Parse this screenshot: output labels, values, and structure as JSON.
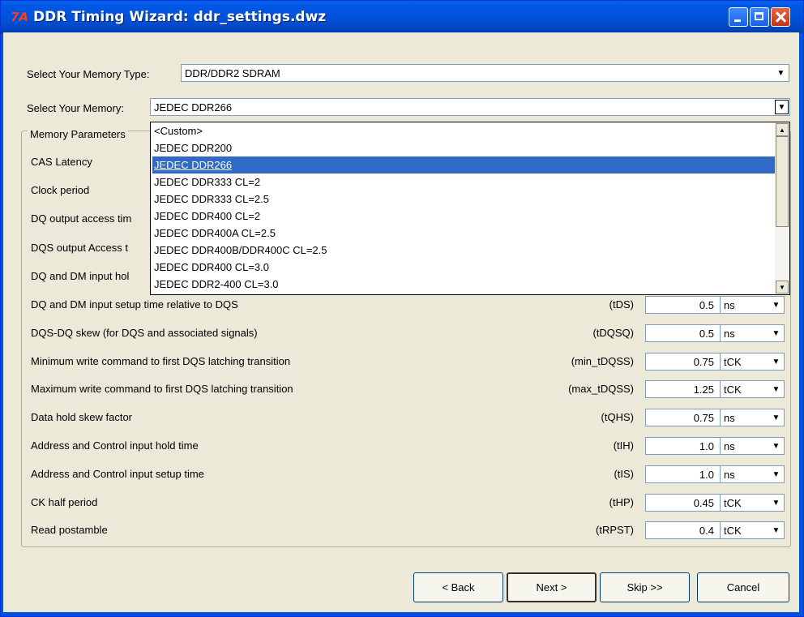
{
  "window": {
    "icon_text": "7A",
    "title": "DDR Timing Wizard: ddr_settings.dwz"
  },
  "memory_type": {
    "label": "Select Your Memory Type:",
    "value": "DDR/DDR2 SDRAM"
  },
  "memory": {
    "label": "Select Your Memory:",
    "value": "JEDEC DDR266",
    "options": [
      "<Custom>",
      "JEDEC DDR200",
      "JEDEC DDR266",
      "JEDEC DDR333 CL=2",
      "JEDEC DDR333 CL=2.5",
      "JEDEC DDR400 CL=2",
      "JEDEC DDR400A CL=2.5",
      "JEDEC DDR400B/DDR400C CL=2.5",
      "JEDEC DDR400 CL=3.0",
      "JEDEC DDR2-400 CL=3.0"
    ],
    "selected_index": 2
  },
  "parameters": {
    "group_title": "Memory Parameters",
    "hidden_labels": [
      "CAS Latency",
      "Clock period",
      "DQ output access tim",
      "DQS output Access t",
      "DQ and DM input hol"
    ],
    "rows": [
      {
        "label": "DQ and DM input setup time relative to DQS",
        "symbol": "(tDS)",
        "value": "0.5",
        "unit": "ns"
      },
      {
        "label": "DQS-DQ skew (for DQS and associated signals)",
        "symbol": "(tDQSQ)",
        "value": "0.5",
        "unit": "ns"
      },
      {
        "label": "Minimum write command to first DQS latching transition",
        "symbol": "(min_tDQSS)",
        "value": "0.75",
        "unit": "tCK"
      },
      {
        "label": "Maximum write command to first DQS latching transition",
        "symbol": "(max_tDQSS)",
        "value": "1.25",
        "unit": "tCK"
      },
      {
        "label": "Data hold skew factor",
        "symbol": "(tQHS)",
        "value": "0.75",
        "unit": "ns"
      },
      {
        "label": "Address and Control input hold time",
        "symbol": "(tIH)",
        "value": "1.0",
        "unit": "ns"
      },
      {
        "label": "Address and Control input setup time",
        "symbol": "(tIS)",
        "value": "1.0",
        "unit": "ns"
      },
      {
        "label": "CK half period",
        "symbol": "(tHP)",
        "value": "0.45",
        "unit": "tCK"
      },
      {
        "label": "Read postamble",
        "symbol": "(tRPST)",
        "value": "0.4",
        "unit": "tCK"
      }
    ]
  },
  "buttons": {
    "back": "< Back",
    "next": "Next >",
    "skip": "Skip >>",
    "cancel": "Cancel"
  },
  "icons": {
    "dropdown": "chevron-down-icon",
    "minimize": "minimize-icon",
    "maximize": "maximize-icon",
    "close": "close-icon"
  },
  "colors": {
    "title_bar": "#0054e3",
    "selection": "#316ac5",
    "window_bg": "#ece9d8"
  }
}
